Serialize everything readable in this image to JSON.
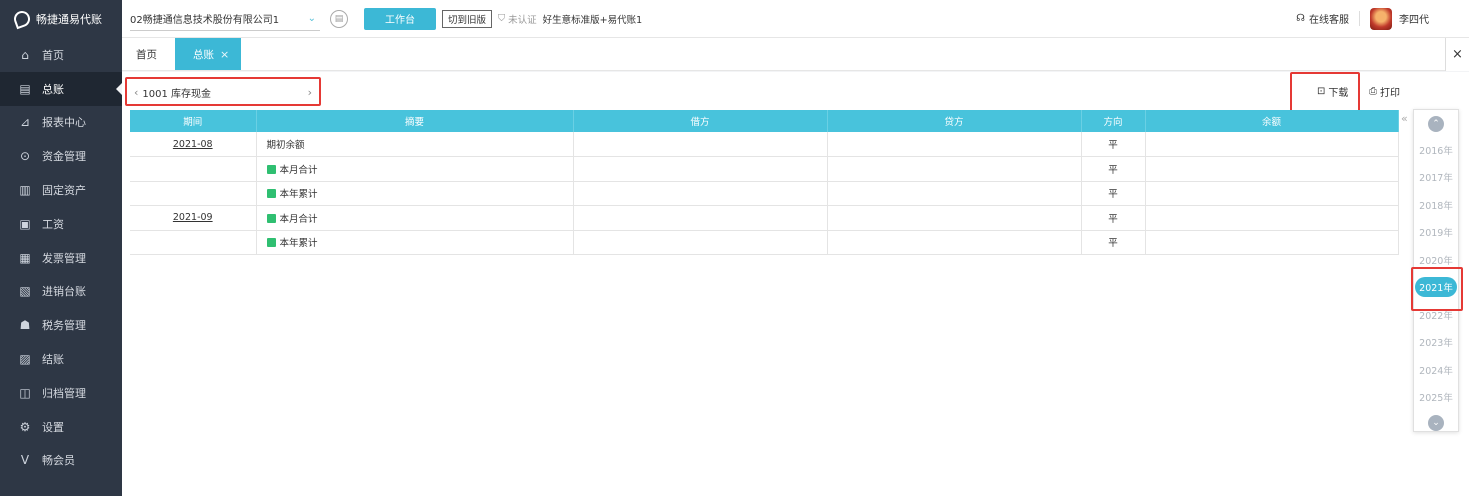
{
  "app": {
    "logo_text": "畅捷通易代账"
  },
  "sidebar": {
    "items": [
      {
        "label": "首页",
        "icon": "⌂",
        "active": false
      },
      {
        "label": "总账",
        "icon": "▤",
        "active": true
      },
      {
        "label": "报表中心",
        "icon": "⊿",
        "active": false
      },
      {
        "label": "资金管理",
        "icon": "⊙",
        "active": false
      },
      {
        "label": "固定资产",
        "icon": "▥",
        "active": false
      },
      {
        "label": "工资",
        "icon": "▣",
        "active": false
      },
      {
        "label": "发票管理",
        "icon": "▦",
        "active": false
      },
      {
        "label": "进销台账",
        "icon": "▧",
        "active": false
      },
      {
        "label": "税务管理",
        "icon": "☗",
        "active": false
      },
      {
        "label": "结账",
        "icon": "▨",
        "active": false
      },
      {
        "label": "归档管理",
        "icon": "◫",
        "active": false
      },
      {
        "label": "设置",
        "icon": "⚙",
        "active": false
      },
      {
        "label": "畅会员",
        "icon": "V",
        "active": false
      }
    ]
  },
  "topbar": {
    "company": "02畅捷通信息技术股份有限公司1",
    "workbench_label": "工作台",
    "switch_old_label": "切到旧版",
    "cert_status": "未认证",
    "version": "好生意标准版+易代账1",
    "online_service": "在线客服",
    "username": "李四代"
  },
  "tabs": [
    {
      "label": "首页",
      "active": false
    },
    {
      "label": "总账",
      "active": true,
      "close": "×"
    }
  ],
  "tabbar_close": "×",
  "toolbar": {
    "subject": "1001 库存现金",
    "prev": "‹",
    "next": "›",
    "download_label": "下载",
    "print_label": "打印"
  },
  "table": {
    "columns": [
      "期间",
      "摘要",
      "借方",
      "贷方",
      "方向",
      "余额"
    ],
    "rows": [
      {
        "period": "2021-08",
        "summary": "期初余额",
        "icon": false,
        "debit": "",
        "credit": "",
        "direction": "平",
        "balance": ""
      },
      {
        "period": "",
        "summary": "本月合计",
        "icon": true,
        "debit": "",
        "credit": "",
        "direction": "平",
        "balance": ""
      },
      {
        "period": "",
        "summary": "本年累计",
        "icon": true,
        "debit": "",
        "credit": "",
        "direction": "平",
        "balance": ""
      },
      {
        "period": "2021-09",
        "summary": "本月合计",
        "icon": true,
        "debit": "",
        "credit": "",
        "direction": "平",
        "balance": ""
      },
      {
        "period": "",
        "summary": "本年累计",
        "icon": true,
        "debit": "",
        "credit": "",
        "direction": "平",
        "balance": ""
      }
    ]
  },
  "years": {
    "collapse": "«",
    "up": "⌃",
    "down": "⌄",
    "list": [
      "2016年",
      "2017年",
      "2018年",
      "2019年",
      "2020年",
      "2021年",
      "2022年",
      "2023年",
      "2024年",
      "2025年"
    ],
    "selected": "2021年"
  },
  "colors": {
    "accent": "#3cb8d6",
    "sidebar_bg": "#2e3745",
    "highlight_box": "#e53935",
    "row_icon": "#2fbf71"
  }
}
